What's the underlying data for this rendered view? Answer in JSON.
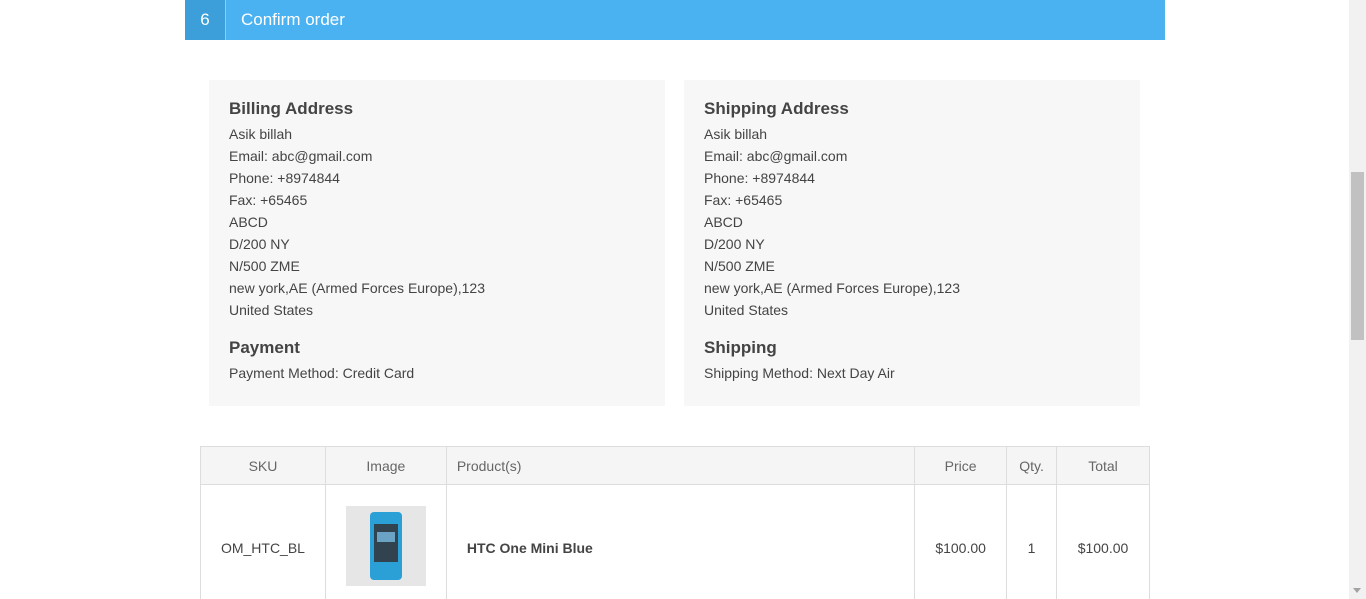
{
  "step": {
    "number": "6",
    "title": "Confirm order"
  },
  "billing": {
    "title": "Billing Address",
    "lines": [
      "Asik billah",
      "Email: abc@gmail.com",
      "Phone: +8974844",
      "Fax: +65465",
      "ABCD",
      "D/200 NY",
      "N/500 ZME",
      "new york,AE (Armed Forces Europe),123",
      "United States"
    ],
    "payment_title": "Payment",
    "payment_method": "Payment Method: Credit Card"
  },
  "shipping": {
    "title": "Shipping Address",
    "lines": [
      "Asik billah",
      "Email: abc@gmail.com",
      "Phone: +8974844",
      "Fax: +65465",
      "ABCD",
      "D/200 NY",
      "N/500 ZME",
      "new york,AE (Armed Forces Europe),123",
      "United States"
    ],
    "shipping_title": "Shipping",
    "shipping_method": "Shipping Method: Next Day Air"
  },
  "cart": {
    "headers": {
      "sku": "SKU",
      "image": "Image",
      "product": "Product(s)",
      "price": "Price",
      "qty": "Qty.",
      "total": "Total"
    },
    "rows": [
      {
        "sku": "OM_HTC_BL",
        "image_icon": "phone-product-image",
        "product": "HTC One Mini Blue",
        "price": "$100.00",
        "qty": "1",
        "total": "$100.00"
      }
    ]
  }
}
